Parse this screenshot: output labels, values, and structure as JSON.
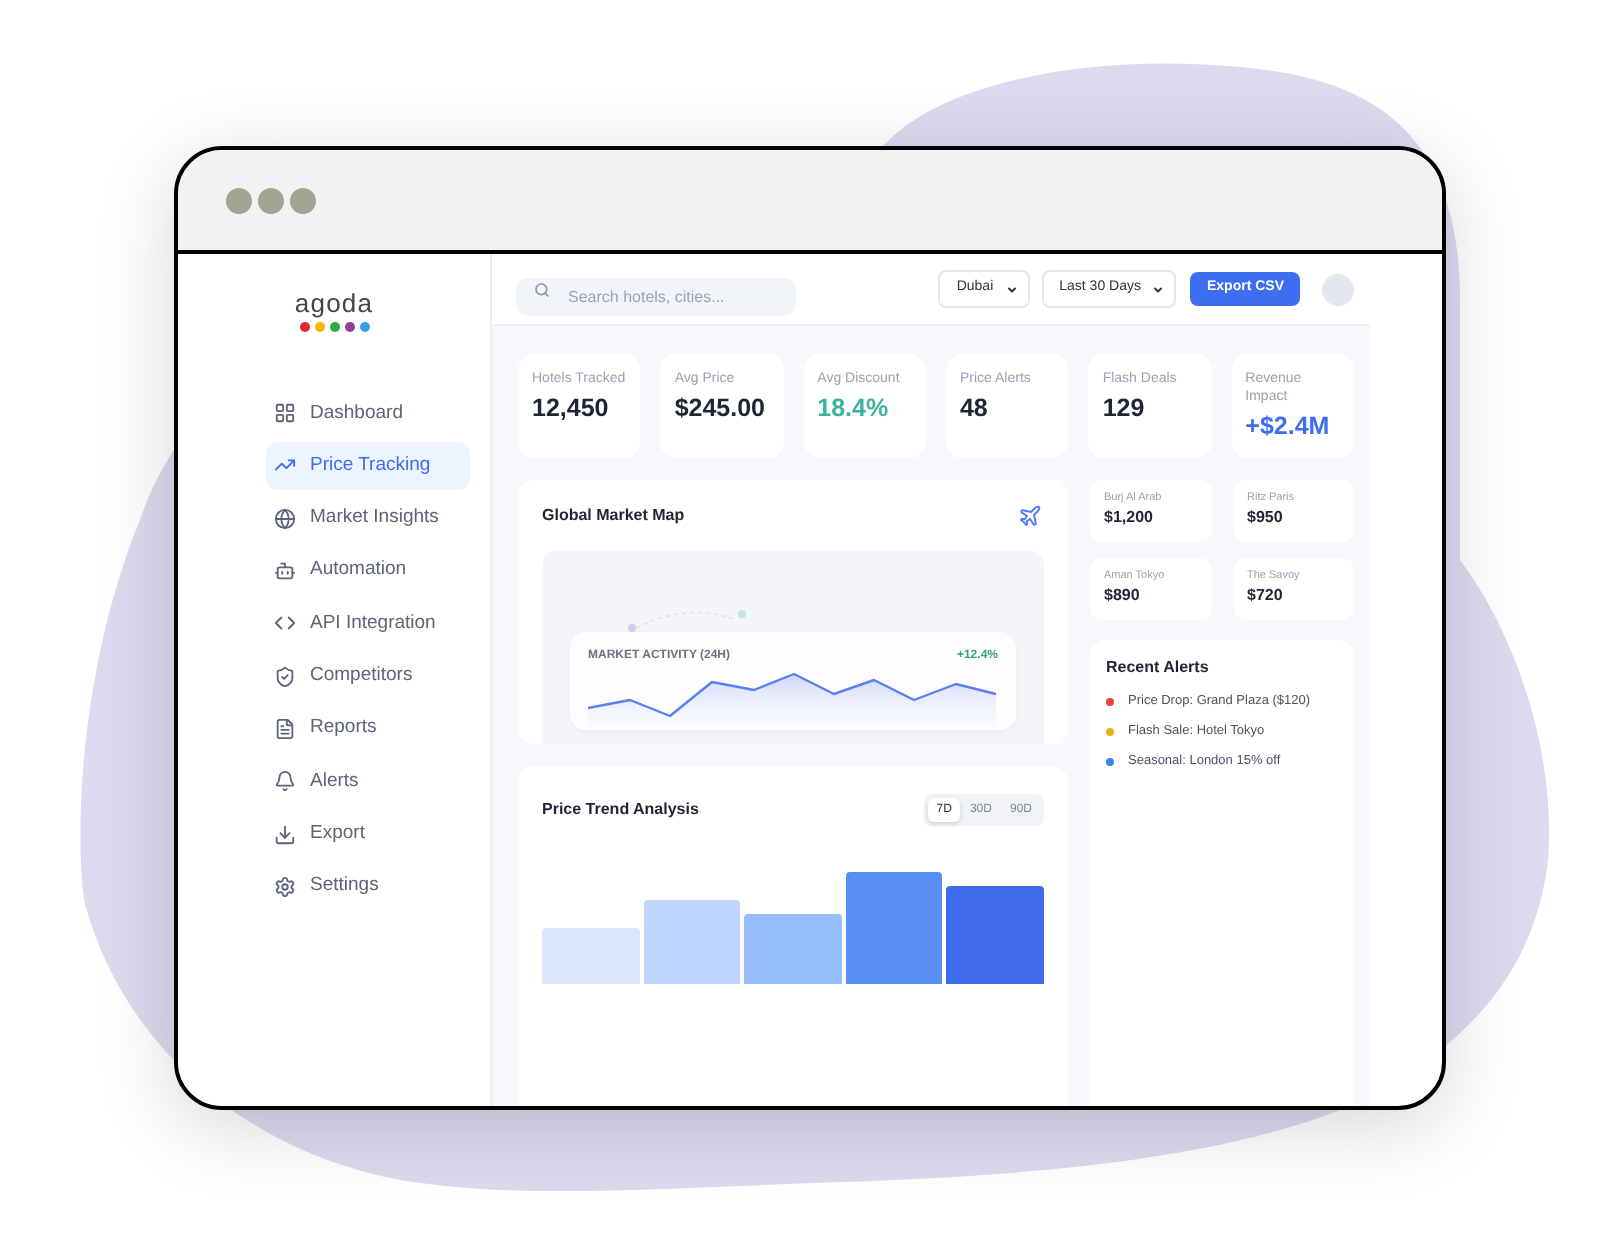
{
  "logo": {
    "text": "agoda"
  },
  "sidebar": {
    "items": [
      {
        "label": "Dashboard",
        "selected": false
      },
      {
        "label": "Price Tracking",
        "selected": true
      },
      {
        "label": "Market Insights",
        "selected": false
      },
      {
        "label": "Automation",
        "selected": false
      },
      {
        "label": "API Integration",
        "selected": false
      },
      {
        "label": "Competitors",
        "selected": false
      },
      {
        "label": "Reports",
        "selected": false
      },
      {
        "label": "Alerts",
        "selected": false
      },
      {
        "label": "Export",
        "selected": false
      },
      {
        "label": "Settings",
        "selected": false
      }
    ]
  },
  "topbar": {
    "search": {
      "placeholder": "Search hotels, cities..."
    },
    "filters": [
      {
        "value": "Dubai"
      },
      {
        "value": "Last 30 Days"
      }
    ],
    "export_button": {
      "label": "Export CSV"
    }
  },
  "stats": [
    {
      "label": "Hotels Tracked",
      "value": "12,450",
      "color": "#1f2533"
    },
    {
      "label": "Avg Price",
      "value": "$245.00",
      "color": "#1f2533"
    },
    {
      "label": "Avg Discount",
      "value": "18.4%",
      "color": "#3bb39b"
    },
    {
      "label": "Price Alerts",
      "value": "48",
      "color": "#1f2533"
    },
    {
      "label": "Flash Deals",
      "value": "129",
      "color": "#1f2533"
    },
    {
      "label": "Revenue Impact",
      "value": "+$2.4M",
      "color": "#3d6ef0"
    }
  ],
  "market_map": {
    "title": "Global Market Map",
    "activity": {
      "label": "MARKET ACTIVITY (24H)",
      "change": "+12.4%"
    }
  },
  "price_trend": {
    "title": "Price Trend Analysis",
    "ranges": [
      {
        "label": "7D",
        "selected": true
      },
      {
        "label": "30D",
        "selected": false
      },
      {
        "label": "90D",
        "selected": false
      }
    ]
  },
  "hotels": [
    {
      "name": "Burj Al Arab",
      "price": "$1,200"
    },
    {
      "name": "Ritz Paris",
      "price": "$950"
    },
    {
      "name": "Aman Tokyo",
      "price": "$890"
    },
    {
      "name": "The Savoy",
      "price": "$720"
    }
  ],
  "recent_alerts": {
    "title": "Recent Alerts",
    "items": [
      {
        "text": "Price Drop: Grand Plaza ($120)",
        "color": "#ef4444"
      },
      {
        "text": "Flash Sale: Hotel Tokyo",
        "color": "#eab308"
      },
      {
        "text": "Seasonal: London 15% off",
        "color": "#3b82f6"
      }
    ]
  }
}
